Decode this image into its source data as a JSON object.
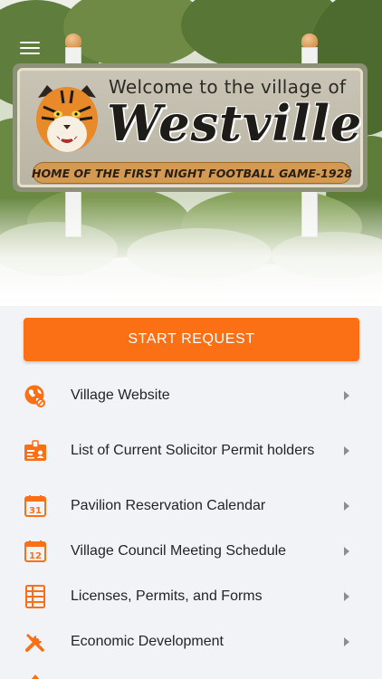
{
  "hero": {
    "sign": {
      "welcome": "Welcome to the village of",
      "name": "Westville",
      "banner": "HOME OF THE FIRST NIGHT FOOTBALL GAME-1928"
    }
  },
  "start_button": {
    "label": "START REQUEST"
  },
  "menu": {
    "items": [
      {
        "label": "Village Website",
        "icon": "globe-icon"
      },
      {
        "label": "List of Current Solicitor Permit holders",
        "icon": "id-card-icon"
      },
      {
        "label": "Pavilion Reservation Calendar",
        "icon": "calendar-31-icon"
      },
      {
        "label": "Village Council Meeting Schedule",
        "icon": "calendar-12-icon"
      },
      {
        "label": "Licenses, Permits, and Forms",
        "icon": "document-list-icon"
      },
      {
        "label": "Economic Development",
        "icon": "tools-icon"
      }
    ]
  },
  "colors": {
    "accent": "#fb7014",
    "background": "#f2f3f6",
    "text": "#222428",
    "chevron": "#8a8d93"
  }
}
